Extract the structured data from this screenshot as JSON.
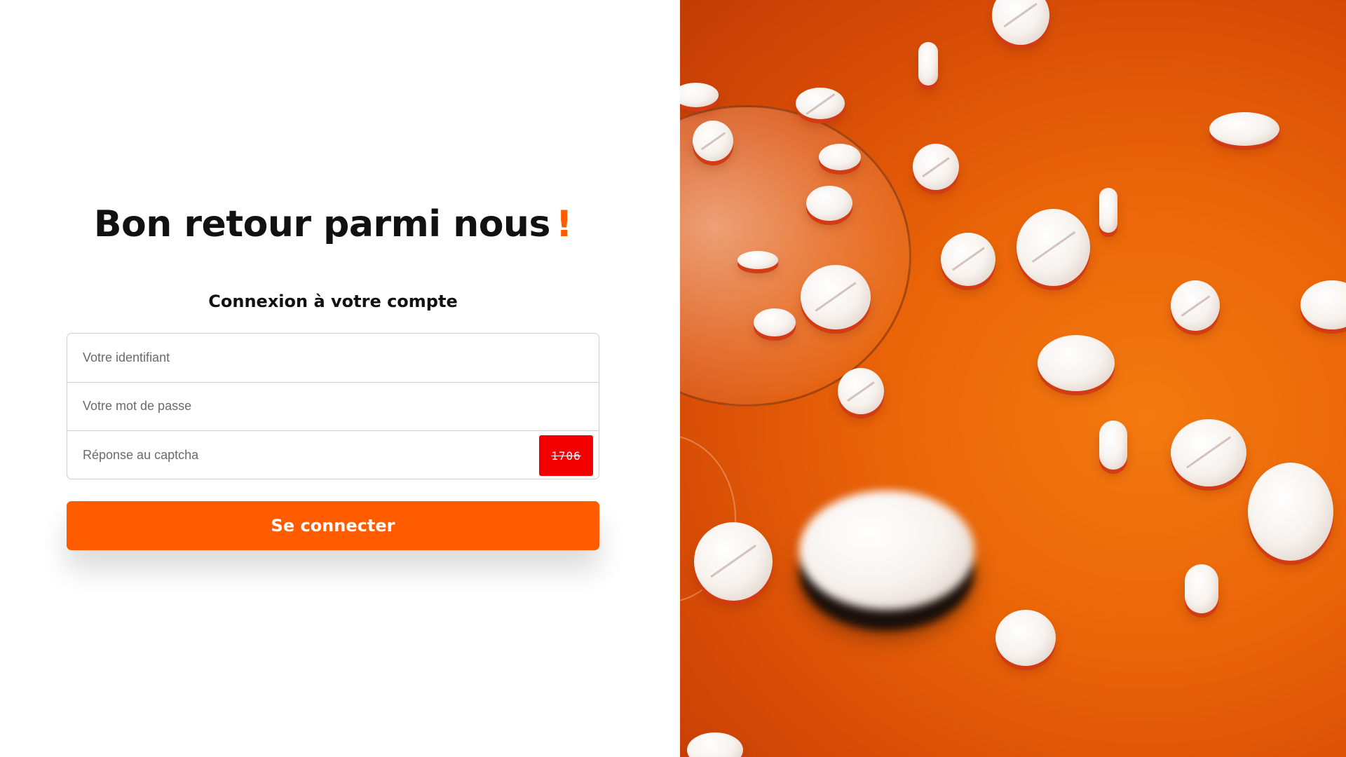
{
  "colors": {
    "accent": "#FF5C00",
    "captcha_bg": "#F20000"
  },
  "header": {
    "title": "Bon retour parmi nous",
    "title_mark": "!",
    "subtitle": "Connexion à votre compte"
  },
  "form": {
    "identifier_placeholder": "Votre identifiant",
    "password_placeholder": "Votre mot de passe",
    "captcha_placeholder": "Réponse au captcha",
    "captcha_code": "1706",
    "submit_label": "Se connecter"
  },
  "hero": {
    "image_subject": "pills-falling-from-glass-icon"
  }
}
